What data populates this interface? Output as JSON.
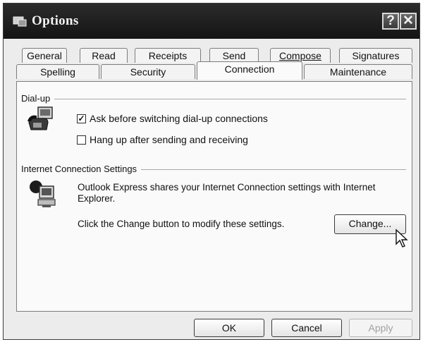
{
  "window": {
    "title": "Options"
  },
  "tabs_row1": [
    "General",
    "Read",
    "Receipts",
    "Send",
    "Compose",
    "Signatures"
  ],
  "tabs_row2": [
    "Spelling",
    "Security",
    "Connection",
    "Maintenance"
  ],
  "active_tab": "Connection",
  "dialup": {
    "group_label": "Dial-up",
    "ask_label": "Ask before switching dial-up connections",
    "ask_checked": true,
    "hangup_label": "Hang up after sending and receiving",
    "hangup_checked": false
  },
  "internet": {
    "group_label": "Internet Connection Settings",
    "description": "Outlook Express shares your Internet Connection settings with Internet Explorer.",
    "change_hint": "Click the Change button to modify these settings.",
    "change_button": "Change..."
  },
  "footer": {
    "ok": "OK",
    "cancel": "Cancel",
    "apply": "Apply"
  },
  "icons": {
    "title": "options-icon",
    "dialup": "dialup-phone-icon",
    "internet": "globe-computer-icon",
    "cursor": "mouse-pointer-icon"
  }
}
